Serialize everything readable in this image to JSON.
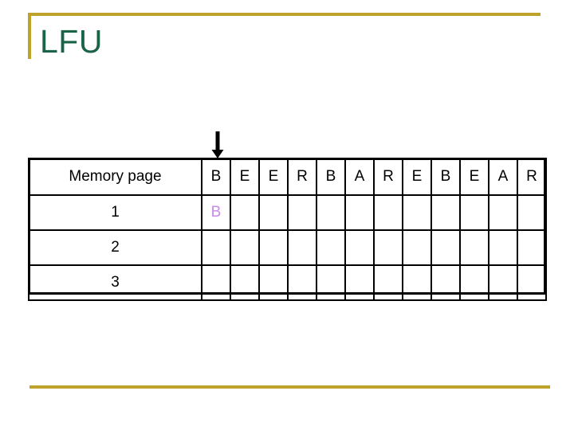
{
  "slide": {
    "title": "LFU",
    "accent_color": "#bfa22a",
    "title_color": "#1a6347"
  },
  "annotations": {
    "arrow": {
      "name": "down-arrow",
      "points_to_column": 1,
      "color": "#000000"
    }
  },
  "table": {
    "label_header": "Memory page",
    "reference_string": [
      "B",
      "E",
      "E",
      "R",
      "B",
      "A",
      "R",
      "E",
      "B",
      "E",
      "A",
      "R"
    ],
    "rows": [
      {
        "label": "1",
        "cells": [
          "B",
          "",
          "",
          "",
          "",
          "",
          "",
          "",
          "",
          "",
          "",
          ""
        ]
      },
      {
        "label": "2",
        "cells": [
          "",
          "",
          "",
          "",
          "",
          "",
          "",
          "",
          "",
          "",
          "",
          ""
        ]
      },
      {
        "label": "3",
        "cells": [
          "",
          "",
          "",
          "",
          "",
          "",
          "",
          "",
          "",
          "",
          "",
          ""
        ]
      }
    ],
    "fill_color": "#cb89e8",
    "border_color": "#000000"
  }
}
